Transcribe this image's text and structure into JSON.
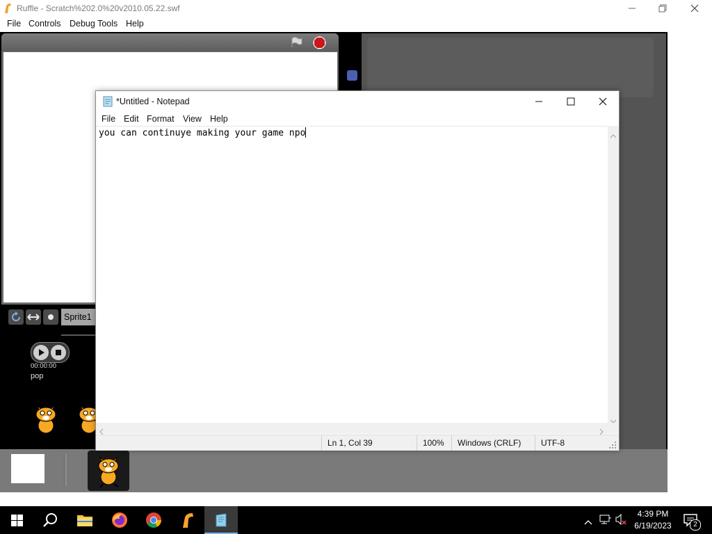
{
  "ruffle": {
    "title": "Ruffle - Scratch%202.0%20v2010.05.22.swf",
    "menu": [
      "File",
      "Controls",
      "Debug Tools",
      "Help"
    ]
  },
  "scratch": {
    "sprite_name": "Sprite1",
    "sound_time": "00:00:00",
    "sound_name": "pop"
  },
  "notepad": {
    "title": "*Untitled - Notepad",
    "menu": [
      "File",
      "Edit",
      "Format",
      "View",
      "Help"
    ],
    "text": "you can continuye making your game npo",
    "status": {
      "position": "Ln 1, Col 39",
      "zoom": "100%",
      "line_ending": "Windows (CRLF)",
      "encoding": "UTF-8"
    }
  },
  "taskbar": {
    "time": "4:39 PM",
    "date": "6/19/2023",
    "notification_count": "2",
    "icons": [
      "windows-start-icon",
      "search-icon",
      "file-explorer-icon",
      "firefox-icon",
      "chrome-icon",
      "ruffle-icon",
      "notepad-icon"
    ]
  }
}
